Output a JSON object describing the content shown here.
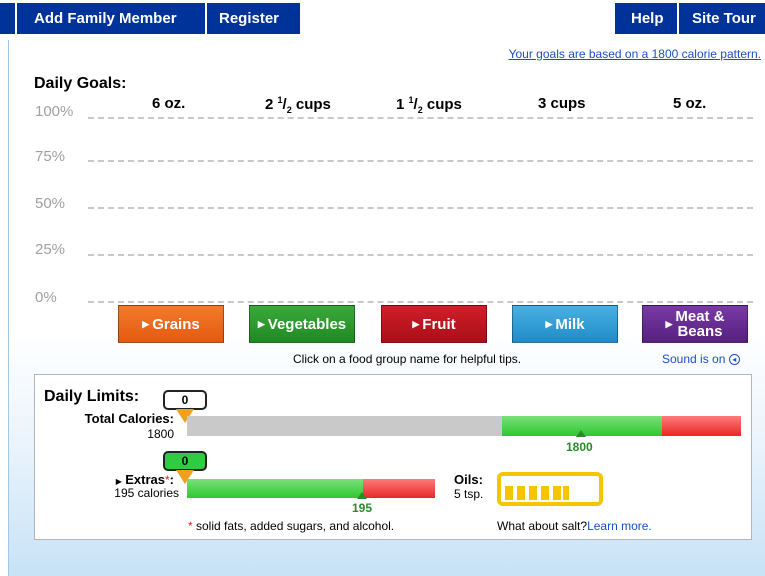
{
  "nav": {
    "add_family_member": "Add Family Member",
    "register": "Register",
    "help": "Help",
    "site_tour": "Site Tour"
  },
  "header": {
    "goals_link": "Your goals are based on a 1800 calorie pattern."
  },
  "daily_goals": {
    "title": "Daily Goals:",
    "grains": "6 oz.",
    "vegetables_whole": "2",
    "vegetables_num": "1",
    "vegetables_den": "2",
    "vegetables_unit": " cups",
    "fruit_whole": "1",
    "fruit_num": "1",
    "fruit_den": "2",
    "fruit_unit": " cups",
    "milk": "3 cups",
    "meat_beans": "5 oz."
  },
  "chart_axis": {
    "p100": "100%",
    "p75": "75%",
    "p50": "50%",
    "p25": "25%",
    "p0": "0%"
  },
  "food_groups": {
    "grains": "Grains",
    "vegetables": "Vegetables",
    "fruit": "Fruit",
    "milk": "Milk",
    "meat_line1": "Meat &",
    "meat_line2": "Beans"
  },
  "tips_text": "Click on a food group name for helpful tips.",
  "sound_text": "Sound is on",
  "daily_limits": {
    "title": "Daily Limits:",
    "calories_bubble": "0",
    "calories_label": "Total Calories:",
    "calories_value": "1800",
    "calories_marker": "1800",
    "extras_bubble": "0",
    "extras_label": "Extras",
    "extras_star": "*",
    "extras_colon": ":",
    "extras_value": "195 calories",
    "extras_marker": "195",
    "oils_label": "Oils:",
    "oils_value": "5 tsp.",
    "footnote_star": "*",
    "footnote_text": " solid fats, added sugars, and alcohol.",
    "salt_text": "What about salt?",
    "salt_link": "Learn more."
  },
  "colors": {
    "nav": "#003399",
    "grains": "#e35a10",
    "vegetables": "#1f8a22",
    "fruit": "#a80f18",
    "milk": "#1f8bc8",
    "meat_beans": "#55207f",
    "limit_ok": "#2ec82e",
    "limit_over": "#e82828",
    "oils": "#f5c600"
  }
}
